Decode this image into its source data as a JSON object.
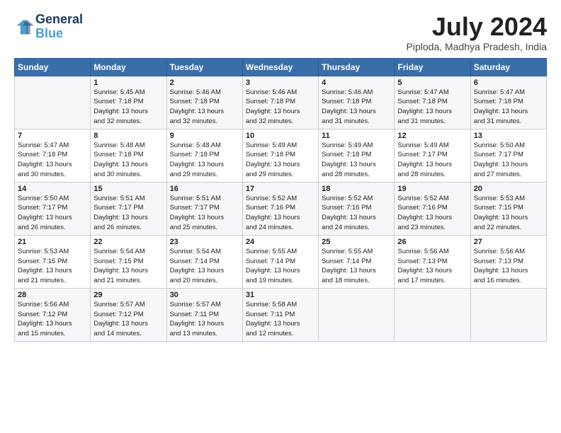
{
  "header": {
    "logo_line1": "General",
    "logo_line2": "Blue",
    "month_title": "July 2024",
    "location": "Piploda, Madhya Pradesh, India"
  },
  "days_of_week": [
    "Sunday",
    "Monday",
    "Tuesday",
    "Wednesday",
    "Thursday",
    "Friday",
    "Saturday"
  ],
  "weeks": [
    [
      {
        "day": "",
        "info": ""
      },
      {
        "day": "1",
        "info": "Sunrise: 5:45 AM\nSunset: 7:18 PM\nDaylight: 13 hours\nand 32 minutes."
      },
      {
        "day": "2",
        "info": "Sunrise: 5:46 AM\nSunset: 7:18 PM\nDaylight: 13 hours\nand 32 minutes."
      },
      {
        "day": "3",
        "info": "Sunrise: 5:46 AM\nSunset: 7:18 PM\nDaylight: 13 hours\nand 32 minutes."
      },
      {
        "day": "4",
        "info": "Sunrise: 5:46 AM\nSunset: 7:18 PM\nDaylight: 13 hours\nand 31 minutes."
      },
      {
        "day": "5",
        "info": "Sunrise: 5:47 AM\nSunset: 7:18 PM\nDaylight: 13 hours\nand 31 minutes."
      },
      {
        "day": "6",
        "info": "Sunrise: 5:47 AM\nSunset: 7:18 PM\nDaylight: 13 hours\nand 31 minutes."
      }
    ],
    [
      {
        "day": "7",
        "info": "Sunrise: 5:47 AM\nSunset: 7:18 PM\nDaylight: 13 hours\nand 30 minutes."
      },
      {
        "day": "8",
        "info": "Sunrise: 5:48 AM\nSunset: 7:18 PM\nDaylight: 13 hours\nand 30 minutes."
      },
      {
        "day": "9",
        "info": "Sunrise: 5:48 AM\nSunset: 7:18 PM\nDaylight: 13 hours\nand 29 minutes."
      },
      {
        "day": "10",
        "info": "Sunrise: 5:49 AM\nSunset: 7:18 PM\nDaylight: 13 hours\nand 29 minutes."
      },
      {
        "day": "11",
        "info": "Sunrise: 5:49 AM\nSunset: 7:18 PM\nDaylight: 13 hours\nand 28 minutes."
      },
      {
        "day": "12",
        "info": "Sunrise: 5:49 AM\nSunset: 7:17 PM\nDaylight: 13 hours\nand 28 minutes."
      },
      {
        "day": "13",
        "info": "Sunrise: 5:50 AM\nSunset: 7:17 PM\nDaylight: 13 hours\nand 27 minutes."
      }
    ],
    [
      {
        "day": "14",
        "info": "Sunrise: 5:50 AM\nSunset: 7:17 PM\nDaylight: 13 hours\nand 26 minutes."
      },
      {
        "day": "15",
        "info": "Sunrise: 5:51 AM\nSunset: 7:17 PM\nDaylight: 13 hours\nand 26 minutes."
      },
      {
        "day": "16",
        "info": "Sunrise: 5:51 AM\nSunset: 7:17 PM\nDaylight: 13 hours\nand 25 minutes."
      },
      {
        "day": "17",
        "info": "Sunrise: 5:52 AM\nSunset: 7:16 PM\nDaylight: 13 hours\nand 24 minutes."
      },
      {
        "day": "18",
        "info": "Sunrise: 5:52 AM\nSunset: 7:16 PM\nDaylight: 13 hours\nand 24 minutes."
      },
      {
        "day": "19",
        "info": "Sunrise: 5:52 AM\nSunset: 7:16 PM\nDaylight: 13 hours\nand 23 minutes."
      },
      {
        "day": "20",
        "info": "Sunrise: 5:53 AM\nSunset: 7:15 PM\nDaylight: 13 hours\nand 22 minutes."
      }
    ],
    [
      {
        "day": "21",
        "info": "Sunrise: 5:53 AM\nSunset: 7:15 PM\nDaylight: 13 hours\nand 21 minutes."
      },
      {
        "day": "22",
        "info": "Sunrise: 5:54 AM\nSunset: 7:15 PM\nDaylight: 13 hours\nand 21 minutes."
      },
      {
        "day": "23",
        "info": "Sunrise: 5:54 AM\nSunset: 7:14 PM\nDaylight: 13 hours\nand 20 minutes."
      },
      {
        "day": "24",
        "info": "Sunrise: 5:55 AM\nSunset: 7:14 PM\nDaylight: 13 hours\nand 19 minutes."
      },
      {
        "day": "25",
        "info": "Sunrise: 5:55 AM\nSunset: 7:14 PM\nDaylight: 13 hours\nand 18 minutes."
      },
      {
        "day": "26",
        "info": "Sunrise: 5:56 AM\nSunset: 7:13 PM\nDaylight: 13 hours\nand 17 minutes."
      },
      {
        "day": "27",
        "info": "Sunrise: 5:56 AM\nSunset: 7:13 PM\nDaylight: 13 hours\nand 16 minutes."
      }
    ],
    [
      {
        "day": "28",
        "info": "Sunrise: 5:56 AM\nSunset: 7:12 PM\nDaylight: 13 hours\nand 15 minutes."
      },
      {
        "day": "29",
        "info": "Sunrise: 5:57 AM\nSunset: 7:12 PM\nDaylight: 13 hours\nand 14 minutes."
      },
      {
        "day": "30",
        "info": "Sunrise: 5:57 AM\nSunset: 7:11 PM\nDaylight: 13 hours\nand 13 minutes."
      },
      {
        "day": "31",
        "info": "Sunrise: 5:58 AM\nSunset: 7:11 PM\nDaylight: 13 hours\nand 12 minutes."
      },
      {
        "day": "",
        "info": ""
      },
      {
        "day": "",
        "info": ""
      },
      {
        "day": "",
        "info": ""
      }
    ]
  ]
}
